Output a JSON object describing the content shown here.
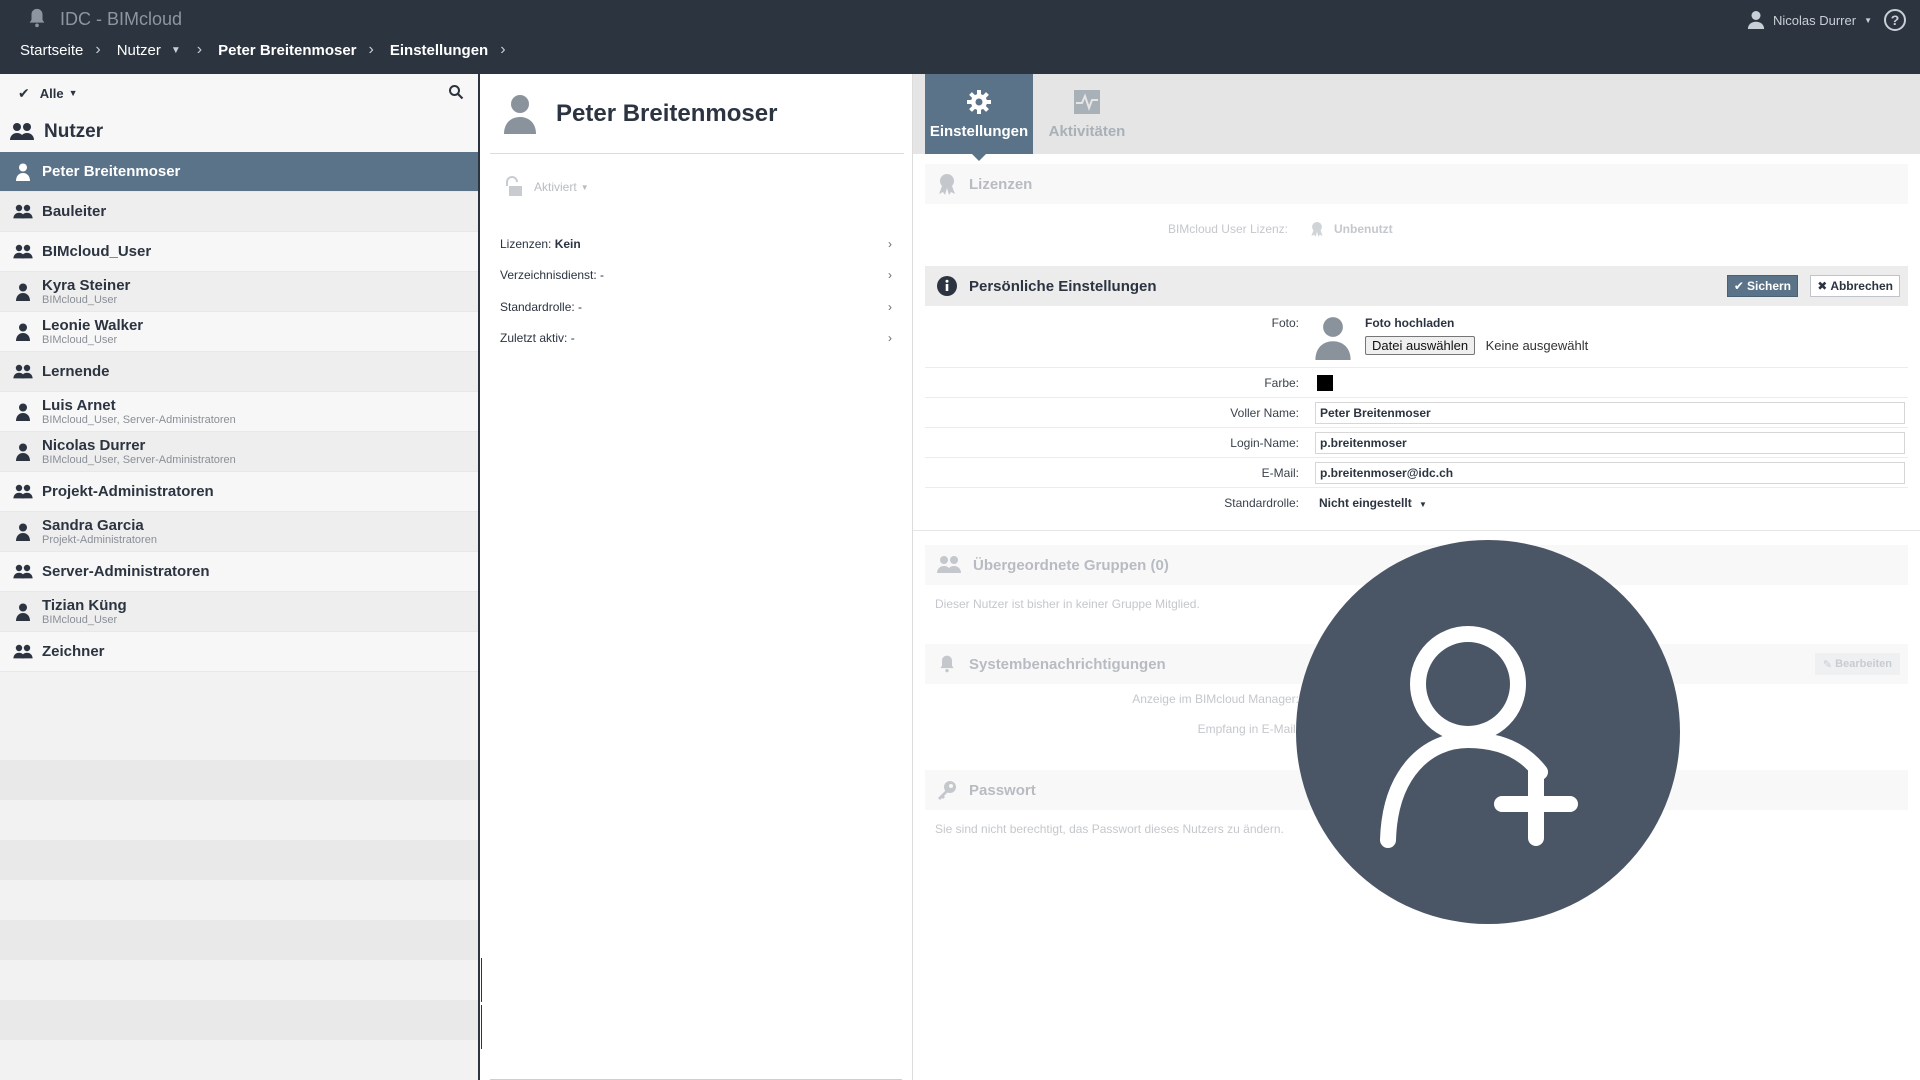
{
  "app": {
    "title": "IDC - BIMcloud"
  },
  "user_menu": {
    "name": "Nicolas Durrer",
    "help": "?"
  },
  "breadcrumb": {
    "items": [
      "Startseite",
      "Nutzer",
      "Peter Breitenmoser",
      "Einstellungen"
    ]
  },
  "left": {
    "filter_label": "Alle",
    "section_title": "Nutzer",
    "items": [
      {
        "name": "Peter Breitenmoser",
        "sub": "",
        "type": "user",
        "selected": true
      },
      {
        "name": "Bauleiter",
        "sub": "",
        "type": "group"
      },
      {
        "name": "BIMcloud_User",
        "sub": "",
        "type": "group"
      },
      {
        "name": "Kyra Steiner",
        "sub": "BIMcloud_User",
        "type": "user"
      },
      {
        "name": "Leonie Walker",
        "sub": "BIMcloud_User",
        "type": "user"
      },
      {
        "name": "Lernende",
        "sub": "",
        "type": "group"
      },
      {
        "name": "Luis Arnet",
        "sub": "BIMcloud_User, Server-Administratoren",
        "type": "user"
      },
      {
        "name": "Nicolas Durrer",
        "sub": "BIMcloud_User, Server-Administratoren",
        "type": "user"
      },
      {
        "name": "Projekt-Administratoren",
        "sub": "",
        "type": "group"
      },
      {
        "name": "Sandra Garcia",
        "sub": "Projekt-Administratoren",
        "type": "user"
      },
      {
        "name": "Server-Administratoren",
        "sub": "",
        "type": "group"
      },
      {
        "name": "Tizian Küng",
        "sub": "BIMcloud_User",
        "type": "user"
      },
      {
        "name": "Zeichner",
        "sub": "",
        "type": "group"
      }
    ]
  },
  "middle": {
    "title": "Peter Breitenmoser",
    "status": "Aktiviert",
    "props": [
      {
        "label": "Lizenzen: ",
        "value": "Kein"
      },
      {
        "label": "Verzeichnisdienst: -",
        "value": ""
      },
      {
        "label": "Standardrolle: -",
        "value": ""
      },
      {
        "label": "Zuletzt aktiv: -",
        "value": ""
      }
    ]
  },
  "tabs": {
    "settings": "Einstellungen",
    "activities": "Aktivitäten"
  },
  "licenses": {
    "title": "Lizenzen",
    "label": "BIMcloud User Lizenz:",
    "value": "Unbenutzt"
  },
  "personal": {
    "title": "Persönliche Einstellungen",
    "save": "Sichern",
    "cancel": "Abbrechen",
    "photo_label": "Foto:",
    "photo_upload": "Foto hochladen",
    "file_button": "Datei auswählen",
    "file_none": "Keine ausgewählt",
    "color_label": "Farbe:",
    "color_value": "#000000",
    "fullname_label": "Voller Name:",
    "fullname": "Peter Breitenmoser",
    "login_label": "Login-Name:",
    "login": "p.breitenmoser",
    "email_label": "E-Mail:",
    "email": "p.breitenmoser@idc.ch",
    "role_label": "Standardrolle:",
    "role": "Nicht eingestellt"
  },
  "groups": {
    "title": "Übergeordnete Gruppen (0)",
    "empty": "Dieser Nutzer ist bisher in keiner Gruppe Mitglied."
  },
  "notifications": {
    "title": "Systembenachrichtigungen",
    "edit": "Bearbeiten",
    "row1": "Anzeige im BIMcloud Manager:",
    "row2": "Empfang in E-Mail:"
  },
  "password": {
    "title": "Passwort",
    "text": "Sie sind nicht berechtigt, das Passwort dieses Nutzers zu ändern."
  },
  "colors": {
    "topbar": "#2c3440",
    "accent": "#5b7388",
    "overlay": "#4a5666"
  },
  "overlay_icon": "add-user-icon"
}
